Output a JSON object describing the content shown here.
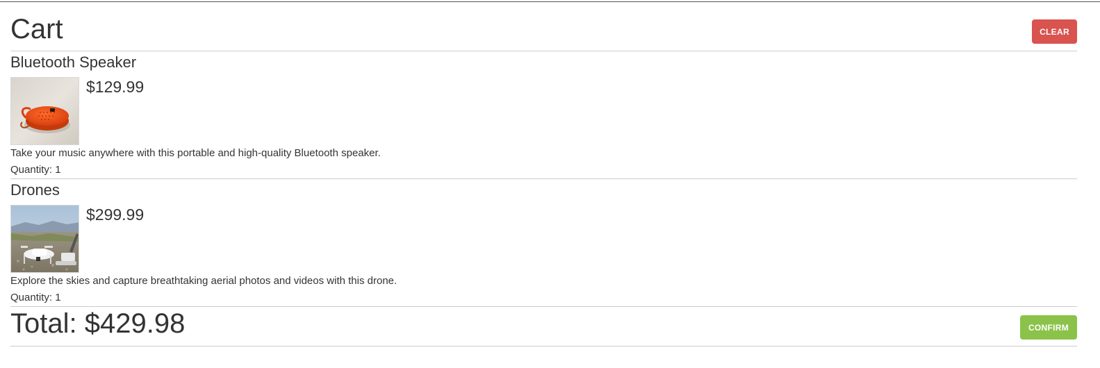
{
  "cart": {
    "title": "Cart",
    "clear_label": "CLEAR",
    "quantity_label": "Quantity:",
    "items": [
      {
        "name": "Bluetooth Speaker",
        "price": "$129.99",
        "description": "Take your music anywhere with this portable and high-quality Bluetooth speaker.",
        "quantity": "1",
        "quantity_text": "Quantity: 1",
        "image_icon": "speaker-photo"
      },
      {
        "name": "Drones",
        "price": "$299.99",
        "description": "Explore the skies and capture breathtaking aerial photos and videos with this drone.",
        "quantity": "1",
        "quantity_text": "Quantity: 1",
        "image_icon": "drone-photo"
      }
    ],
    "total_text": "Total: $429.98",
    "total_value": "$429.98",
    "confirm_label": "CONFIRM"
  },
  "colors": {
    "clear_button": "#d9534f",
    "confirm_button": "#8bc34a",
    "text": "#333333",
    "divider": "#cccccc"
  }
}
